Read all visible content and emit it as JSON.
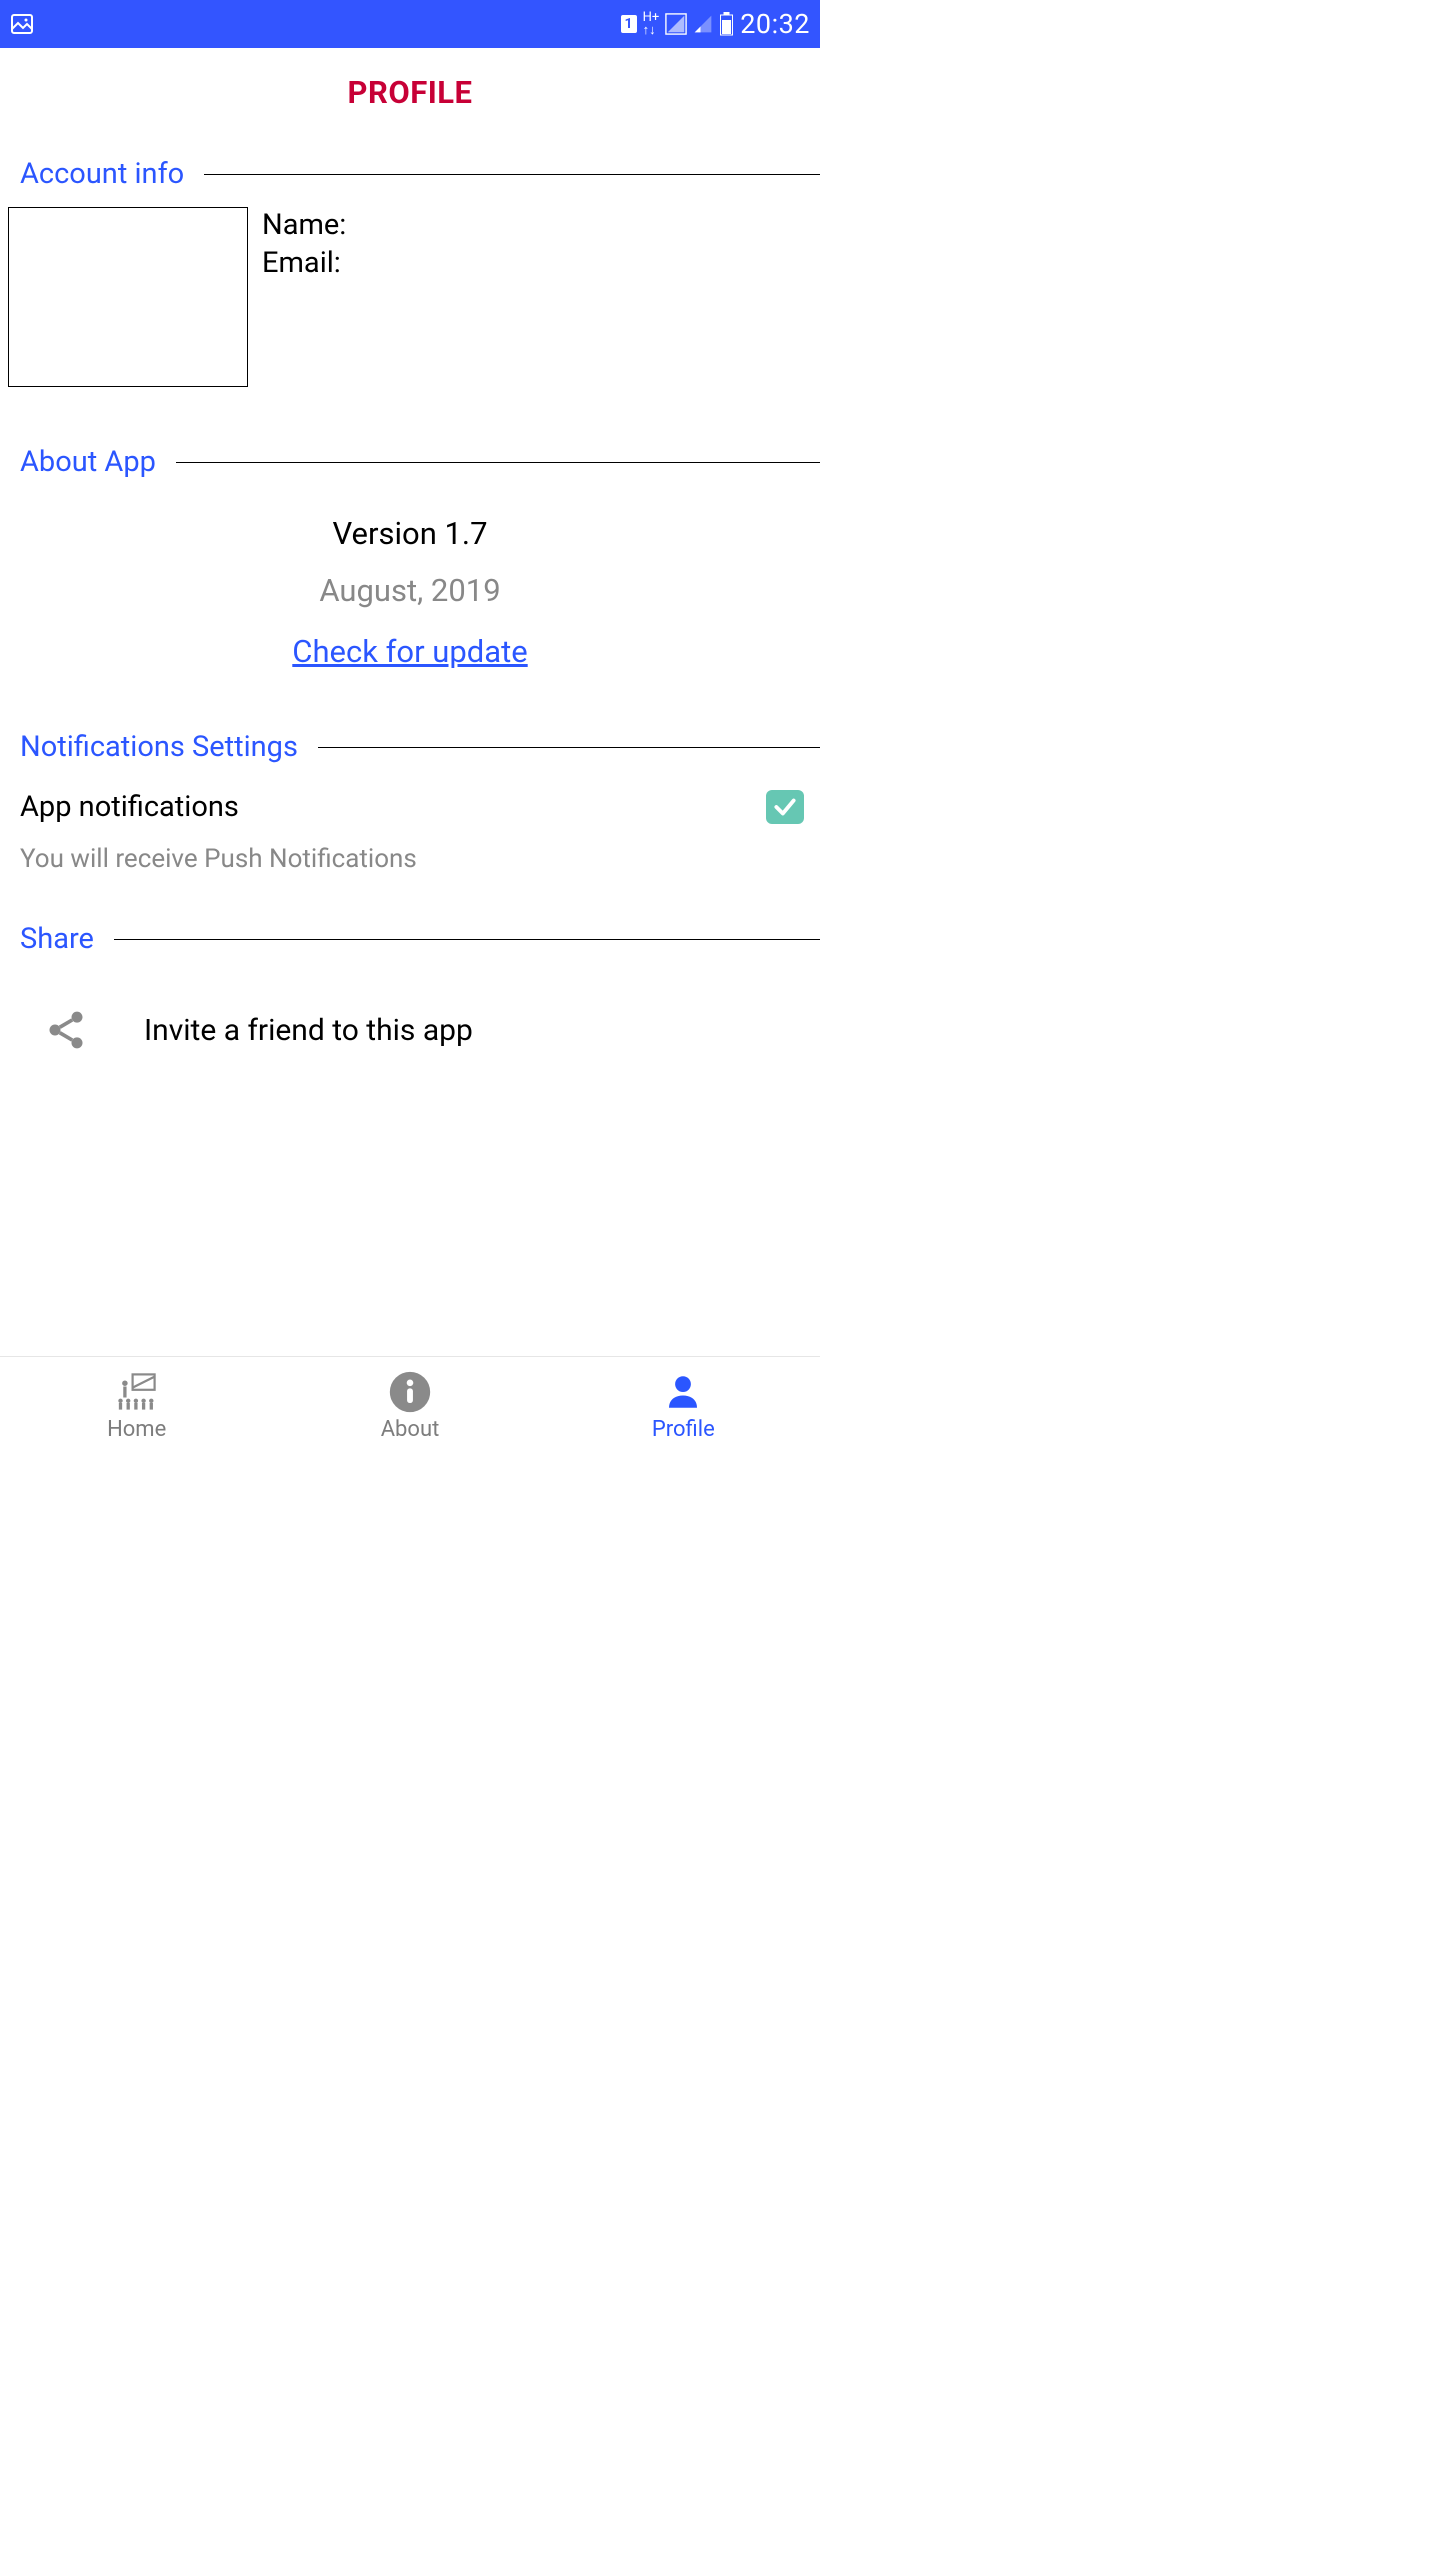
{
  "statusBar": {
    "time": "20:32",
    "simBadge": "1",
    "network": "H+"
  },
  "page": {
    "title": "PROFILE"
  },
  "sections": {
    "account": {
      "title": "Account info",
      "nameLabel": "Name:",
      "emailLabel": "Email:"
    },
    "about": {
      "title": "About App",
      "version": "Version 1.7",
      "date": "August, 2019",
      "updateLink": "Check for update"
    },
    "notifications": {
      "title": "Notifications Settings",
      "label": "App notifications",
      "description": "You will receive Push Notifications",
      "checked": true
    },
    "share": {
      "title": "Share",
      "inviteText": "Invite a friend to this app"
    }
  },
  "bottomNav": {
    "home": "Home",
    "about": "About",
    "profile": "Profile"
  }
}
